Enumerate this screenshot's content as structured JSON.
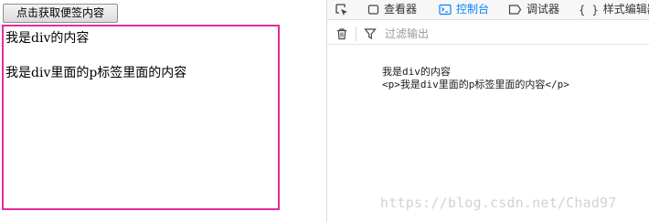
{
  "page": {
    "button_label": "点击获取便签内容",
    "div_text": "我是div的内容",
    "p_text": "我是div里面的p标签里面的内容"
  },
  "devtools": {
    "tabs": [
      {
        "label": "查看器",
        "icon": "inspector-icon"
      },
      {
        "label": "控制台",
        "icon": "console-icon",
        "active": true
      },
      {
        "label": "调试器",
        "icon": "debugger-icon"
      },
      {
        "label": "样式编辑器",
        "icon": "style-editor-icon"
      }
    ],
    "filter_placeholder": "过滤输出",
    "console_lines": [
      "我是div的内容",
      "<p>我是div里面的p标签里面的内容</p>"
    ],
    "accent_color": "#0a84ff"
  },
  "watermark": "https://blog.csdn.net/Chad97"
}
